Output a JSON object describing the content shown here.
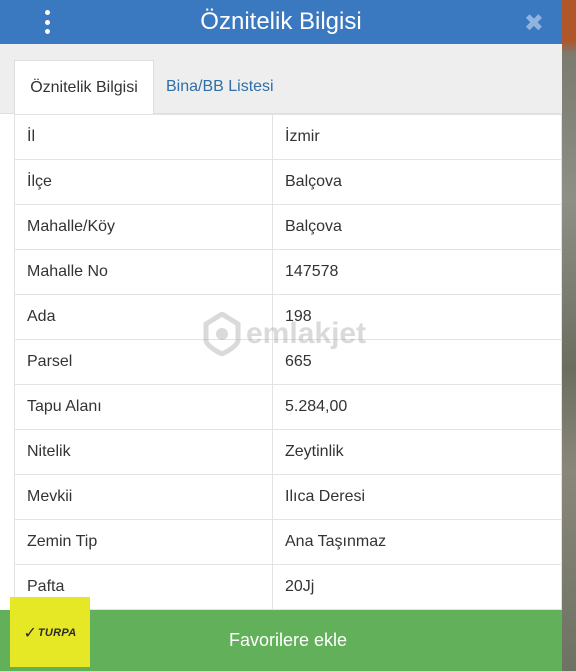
{
  "dialog": {
    "title": "Öznitelik Bilgisi",
    "close_glyph": "✖"
  },
  "tabs": [
    {
      "label": "Öznitelik Bilgisi",
      "active": true
    },
    {
      "label": "Bina/BB Listesi",
      "active": false
    }
  ],
  "attributes": [
    {
      "key": "İl",
      "value": "İzmir"
    },
    {
      "key": "İlçe",
      "value": "Balçova"
    },
    {
      "key": "Mahalle/Köy",
      "value": "Balçova"
    },
    {
      "key": "Mahalle No",
      "value": "147578"
    },
    {
      "key": "Ada",
      "value": "198"
    },
    {
      "key": "Parsel",
      "value": "665"
    },
    {
      "key": "Tapu Alanı",
      "value": "5.284,00"
    },
    {
      "key": "Nitelik",
      "value": "Zeytinlik"
    },
    {
      "key": "Mevkii",
      "value": "Ilıca Deresi"
    },
    {
      "key": "Zemin Tip",
      "value": "Ana Taşınmaz"
    },
    {
      "key": "Pafta",
      "value": "20Jj"
    }
  ],
  "footer": {
    "button_label": "Favorilere ekle"
  },
  "watermark": {
    "text": "emlakjet"
  },
  "badge": {
    "text": "TURPA",
    "check": "✓"
  },
  "colors": {
    "header": "#3a78bf",
    "footer": "#62b05a",
    "badge": "#e6e826",
    "tab_link": "#2f6ea7"
  }
}
